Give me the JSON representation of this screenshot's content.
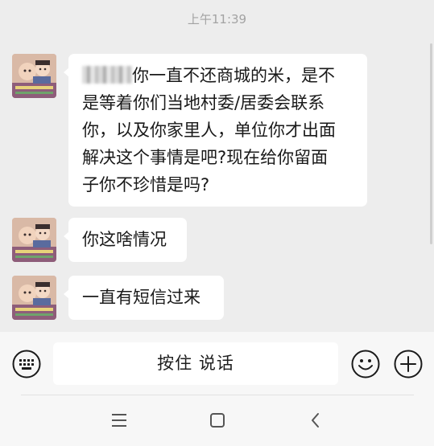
{
  "chat": {
    "timestamp": "上午11:39",
    "messages": [
      {
        "redacted_prefix": true,
        "line1_rest": "你一直不还商城的米，是不",
        "lines": [
          "是等着你们当地村委/居委会联系",
          "你，以及你家里人，单位你才出面",
          "解决这个事情是吧?现在给你留面",
          "子你不珍惜是吗?"
        ]
      },
      {
        "text": "你这啥情况"
      },
      {
        "text": "一直有短信过来"
      }
    ]
  },
  "input_bar": {
    "keyboard_icon": "keyboard-icon",
    "hold_to_talk_label": "按住 说话",
    "emoji_icon": "emoji-icon",
    "add_icon": "plus-circle-icon"
  },
  "nav_bar": {
    "menu_icon": "menu-icon",
    "home_icon": "home-square-icon",
    "back_icon": "back-chevron-icon"
  },
  "colors": {
    "chat_background": "#ededed",
    "bubble": "#ffffff",
    "text": "#191919",
    "timestamp": "#a3a3a3",
    "input_bar": "#f7f7f7"
  }
}
